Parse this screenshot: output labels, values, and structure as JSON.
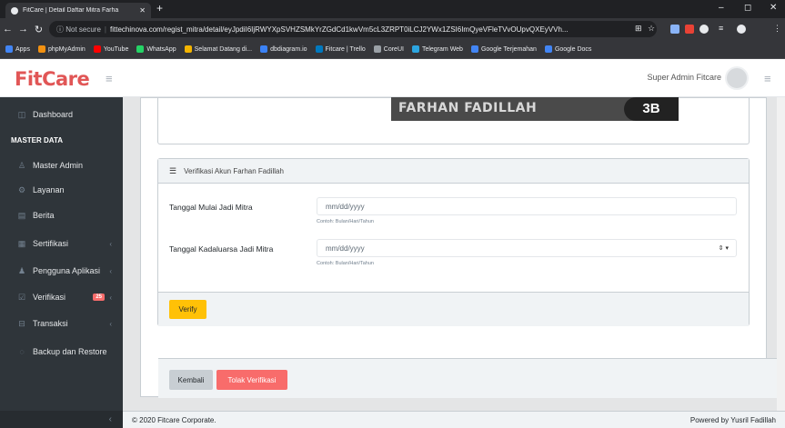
{
  "browser": {
    "tab_title": "FitCare | Detail Daftar Mitra Farha",
    "tab_close": "✕",
    "new_tab": "+",
    "window_controls": {
      "minimize": "–",
      "maximize": "◻",
      "close": "✕"
    },
    "security": "Not secure",
    "url": "fittechinova.com/regist_mitra/detail/eyJpdiI6IjRWYXpSVHZSMkYrZGdCd1kwVm5cL3ZRPT0iLCJ2YWx1ZSI6ImQyeVFleTVvOUpvQXEyVVh...",
    "bookmarks": [
      {
        "label": "Apps",
        "color": "#4285f4"
      },
      {
        "label": "phpMyAdmin",
        "color": "#f29111"
      },
      {
        "label": "YouTube",
        "color": "#ff0000"
      },
      {
        "label": "WhatsApp",
        "color": "#25d366"
      },
      {
        "label": "Selamat Datang di...",
        "color": "#f4b400"
      },
      {
        "label": "dbdiagram.io",
        "color": "#3b82f6"
      },
      {
        "label": "Fitcare | Trello",
        "color": "#0079bf"
      },
      {
        "label": "CoreUI",
        "color": "#9aa0a6"
      },
      {
        "label": "Telegram Web",
        "color": "#2ca5e0"
      },
      {
        "label": "Google Terjemahan",
        "color": "#4285f4"
      },
      {
        "label": "Google Docs",
        "color": "#4285f4"
      }
    ]
  },
  "header": {
    "logo": "FitCare",
    "user": "Super Admin Fitcare"
  },
  "sidebar": {
    "items": [
      {
        "label": "Dashboard",
        "icon": "speedometer-icon",
        "glyph": "◫"
      },
      {
        "label": "Master Admin",
        "icon": "user-icon",
        "glyph": "♙"
      },
      {
        "label": "Layanan",
        "icon": "settings-icon",
        "glyph": "⚙"
      },
      {
        "label": "Berita",
        "icon": "news-icon",
        "glyph": "▤"
      },
      {
        "label": "Sertifikasi",
        "icon": "certificate-icon",
        "glyph": "▦"
      },
      {
        "label": "Pengguna Aplikasi",
        "icon": "users-icon",
        "glyph": "♟"
      },
      {
        "label": "Verifikasi",
        "icon": "check-icon",
        "glyph": "☑"
      },
      {
        "label": "Transaksi",
        "icon": "cart-icon",
        "glyph": "⊟"
      },
      {
        "label": "Backup dan Restore",
        "icon": "backup-icon",
        "glyph": "◌"
      }
    ],
    "section_title": "MASTER DATA",
    "verifikasi_badge": "25",
    "caret": "‹",
    "toggle": "‹"
  },
  "ktp": {
    "name": "FARHAN FADILLAH",
    "number": "3B"
  },
  "verify_card": {
    "title": "Verifikasi Akun Farhan Fadillah",
    "fields": [
      {
        "label": "Tanggal Mulai Jadi Mitra",
        "placeholder": "mm/dd/yyyy",
        "help": "Contoh: Bulan/Hari/Tahun"
      },
      {
        "label": "Tanggal Kadaluarsa Jadi Mitra",
        "placeholder": "mm/dd/yyyy",
        "help": "Contoh: Bulan/Hari/Tahun",
        "spinner": "⇕ ▾"
      }
    ],
    "verify_button": "Verify"
  },
  "actions": {
    "back": "Kembali",
    "reject": "Tolak Verifikasi"
  },
  "footer": {
    "copyright": "© 2020 Fitcare Corporate.",
    "powered": "Powered by Yusril Fadillah"
  }
}
